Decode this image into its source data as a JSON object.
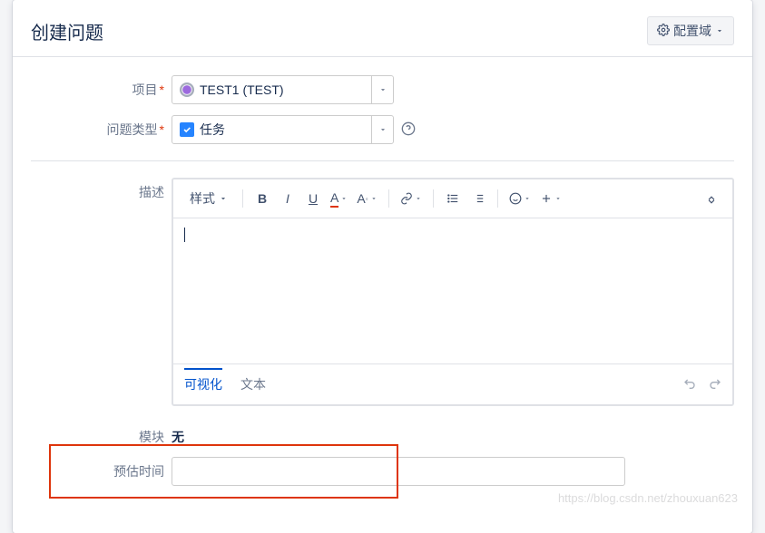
{
  "header": {
    "title": "创建问题",
    "config_label": "配置域"
  },
  "fields": {
    "project_label": "项目",
    "project_value": "TEST1 (TEST)",
    "issuetype_label": "问题类型",
    "issuetype_value": "任务",
    "description_label": "描述",
    "module_label": "模块",
    "module_value": "无",
    "estimate_label": "预估时间",
    "estimate_value": ""
  },
  "toolbar": {
    "style": "样式"
  },
  "editor_tabs": {
    "visual": "可视化",
    "text": "文本"
  },
  "watermark": "https://blog.csdn.net/zhouxuan623"
}
